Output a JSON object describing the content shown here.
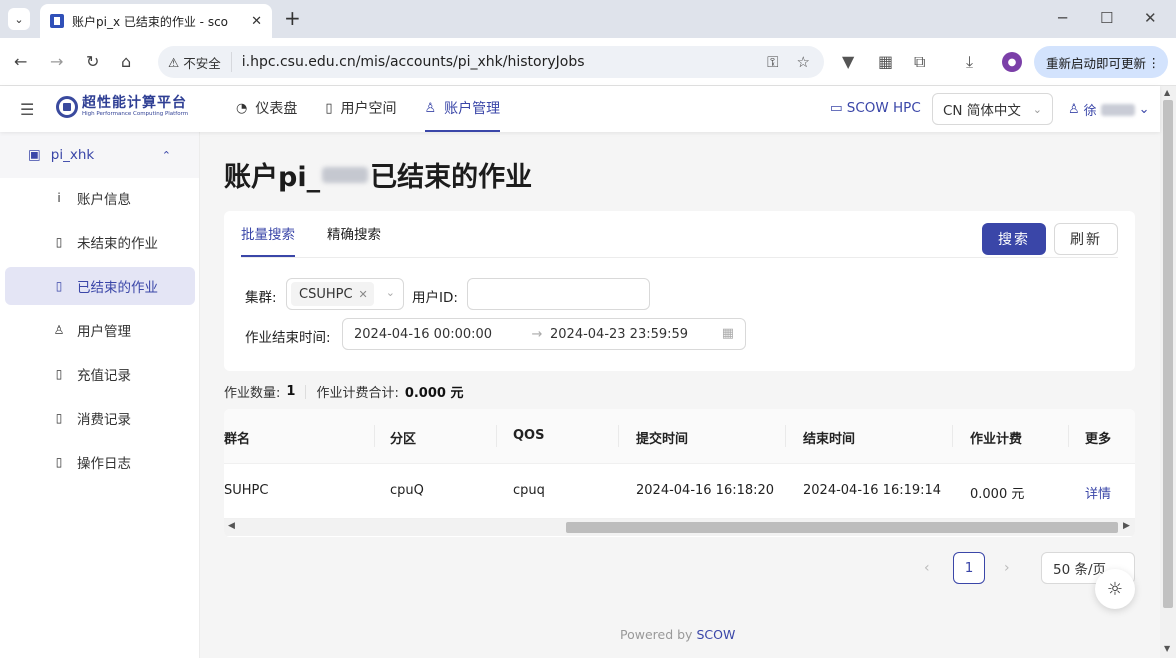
{
  "browser": {
    "tab_title": "账户pi_x 已结束的作业 - sco",
    "url": "i.hpc.csu.edu.cn/mis/accounts/pi_xhk/historyJobs",
    "insecure_label": "不安全",
    "update_label": "重新启动即可更新"
  },
  "header": {
    "logo_cn": "超性能计算平台",
    "logo_en": "High Performance Computing Platform",
    "nav": [
      {
        "label": "仪表盘",
        "icon": "dashboard-icon"
      },
      {
        "label": "用户空间",
        "icon": "book-icon"
      },
      {
        "label": "账户管理",
        "icon": "user-icon"
      }
    ],
    "scow_link": "SCOW HPC",
    "language": "CN 简体中文",
    "user_name_prefix": "徐"
  },
  "sidebar": {
    "group_label": "pi_xhk",
    "items": [
      {
        "label": "账户信息",
        "icon": "info-icon"
      },
      {
        "label": "未结束的作业",
        "icon": "book-icon"
      },
      {
        "label": "已结束的作业",
        "icon": "book-icon"
      },
      {
        "label": "用户管理",
        "icon": "user-icon"
      },
      {
        "label": "充值记录",
        "icon": "book-icon"
      },
      {
        "label": "消费记录",
        "icon": "book-icon"
      },
      {
        "label": "操作日志",
        "icon": "book-icon"
      }
    ]
  },
  "page": {
    "title_prefix": "账户pi_",
    "title_suffix": "已结束的作业"
  },
  "filters": {
    "tabs": [
      "批量搜索",
      "精确搜索"
    ],
    "search_button": "搜索",
    "refresh_button": "刷新",
    "cluster_label": "集群:",
    "cluster_tag": "CSUHPC",
    "user_id_label": "用户ID:",
    "user_id_value": "",
    "end_time_label": "作业结束时间:",
    "range_start": "2024-04-16 00:00:00",
    "range_end": "2024-04-23 23:59:59"
  },
  "summary": {
    "job_count_label": "作业数量:",
    "job_count": "1",
    "fee_label": "作业计费合计:",
    "fee_total": "0.000 元"
  },
  "table": {
    "columns": [
      "群名",
      "分区",
      "QOS",
      "提交时间",
      "结束时间",
      "作业计费",
      "更多"
    ],
    "rows": [
      [
        "SUHPC",
        "cpuQ",
        "cpuq",
        "2024-04-16 16:18:20",
        "2024-04-16 16:19:14",
        "0.000 元",
        "详情"
      ]
    ]
  },
  "pagination": {
    "current_page": "1",
    "page_size": "50 条/页"
  },
  "footer": {
    "powered_by": "Powered by",
    "brand": "SCOW"
  },
  "colors": {
    "primary": "#3a46a8",
    "update_button_bg": "#d3e3fd"
  }
}
